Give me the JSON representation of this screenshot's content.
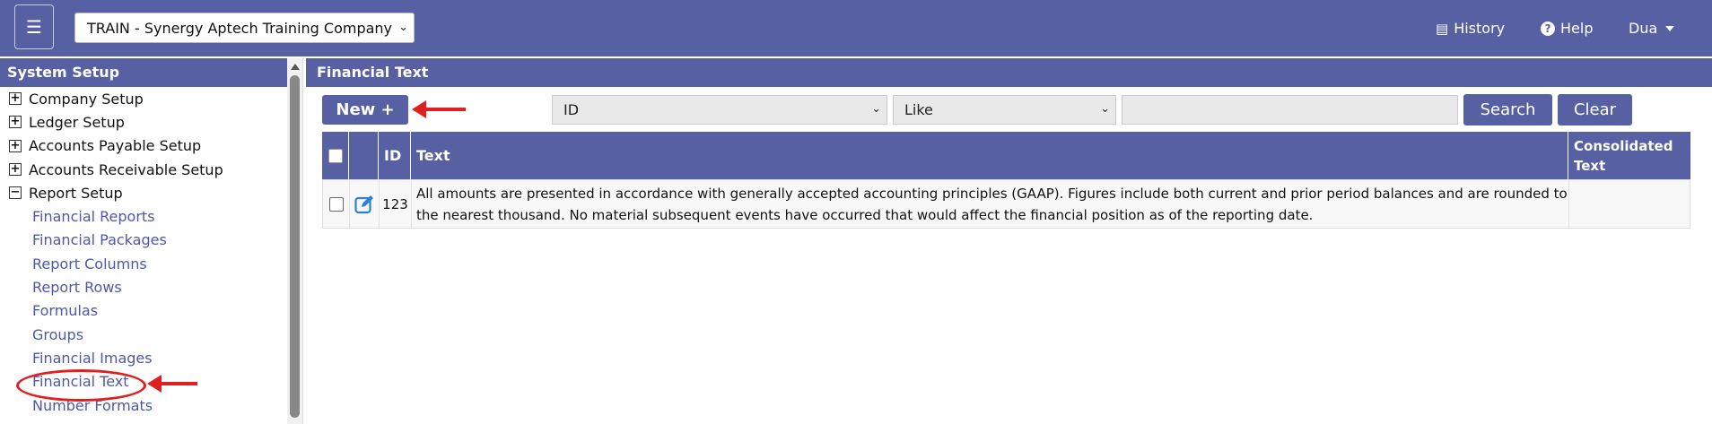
{
  "topbar": {
    "menu_glyph": "☰",
    "company_selector": "TRAIN - Synergy Aptech Training Company",
    "history_label": "History",
    "help_label": "Help",
    "user_label": "Dua"
  },
  "sidebar": {
    "title": "System Setup",
    "groups": [
      {
        "label": "Company Setup",
        "expanded": false,
        "toggle": "+"
      },
      {
        "label": "Ledger Setup",
        "expanded": false,
        "toggle": "+"
      },
      {
        "label": "Accounts Payable Setup",
        "expanded": false,
        "toggle": "+"
      },
      {
        "label": "Accounts Receivable Setup",
        "expanded": false,
        "toggle": "+"
      },
      {
        "label": "Report Setup",
        "expanded": true,
        "toggle": "−"
      }
    ],
    "report_setup_items": [
      "Financial Reports",
      "Financial Packages",
      "Report Columns",
      "Report Rows",
      "Formulas",
      "Groups",
      "Financial Images",
      "Financial Text",
      "Number Formats"
    ],
    "selected_item": "Financial Text"
  },
  "main": {
    "title": "Financial Text",
    "new_button": "New +",
    "filter_field": "ID",
    "filter_operator": "Like",
    "filter_value": "",
    "search_button": "Search",
    "clear_button": "Clear",
    "table": {
      "headers": [
        "",
        "",
        "ID",
        "Text",
        "Consolidated Text"
      ],
      "rows": [
        {
          "id": "123",
          "text": "All amounts are presented in accordance with generally accepted accounting principles (GAAP). Figures include both current and prior period balances and are rounded to the nearest thousand. No material subsequent events have occurred that would affect the financial position as of the reporting date.",
          "consolidated_text": ""
        }
      ]
    }
  },
  "colors": {
    "brand": "#5660a2",
    "link": "#4d58a8",
    "annotation": "#e02020"
  }
}
